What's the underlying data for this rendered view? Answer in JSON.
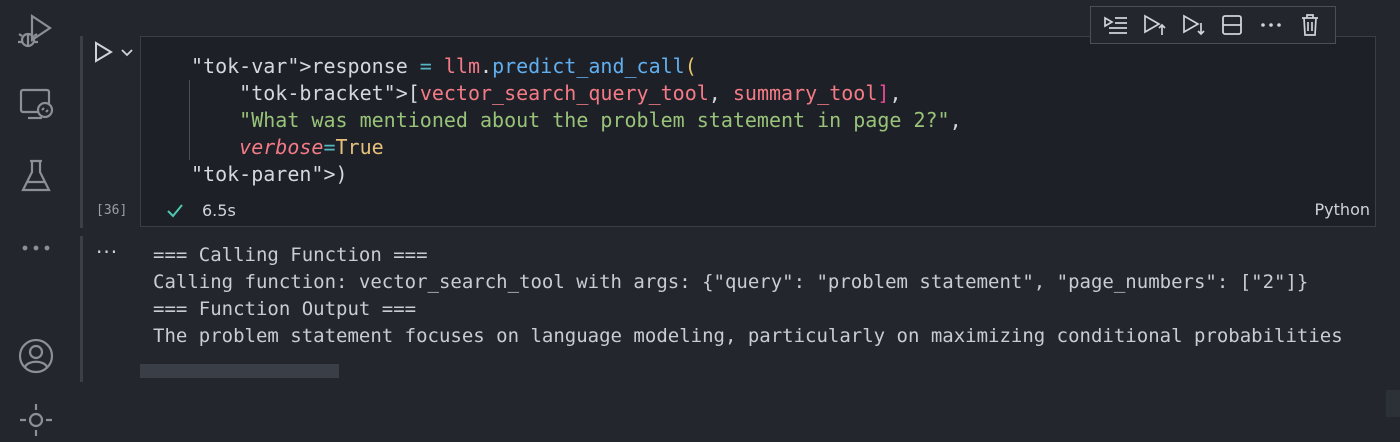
{
  "activity_bar": {
    "icons": [
      "run-debug-icon",
      "remote-explorer-icon",
      "testing-flask-icon",
      "more-icon",
      "account-icon",
      "settings-icon"
    ]
  },
  "cell": {
    "execution_count": "[36]",
    "duration": "6.5s",
    "language": "Python",
    "code_lines": [
      "response = llm.predict_and_call(",
      "    [vector_search_query_tool, summary_tool],",
      "    \"What was mentioned about the problem statement in page 2?\",",
      "    verbose=True",
      ")"
    ]
  },
  "toolbar": {
    "buttons": [
      "execute-above-icon",
      "execute-cell-and-above-icon",
      "execute-cell-and-below-icon",
      "split-cell-icon",
      "more-actions-icon",
      "delete-cell-icon"
    ]
  },
  "output": {
    "ellipsis": "···",
    "lines": [
      "=== Calling Function ===",
      "Calling function: vector_search_tool with args: {\"query\": \"problem statement\", \"page_numbers\": [\"2\"]}",
      "=== Function Output ===",
      "The problem statement focuses on language modeling, particularly on maximizing conditional probabilities"
    ]
  },
  "colors": {
    "background": "#23262d",
    "cell_background": "#1e2027",
    "keyword": "#f47b86",
    "function": "#61afef",
    "string": "#98c379",
    "success": "#4ec9b0"
  }
}
